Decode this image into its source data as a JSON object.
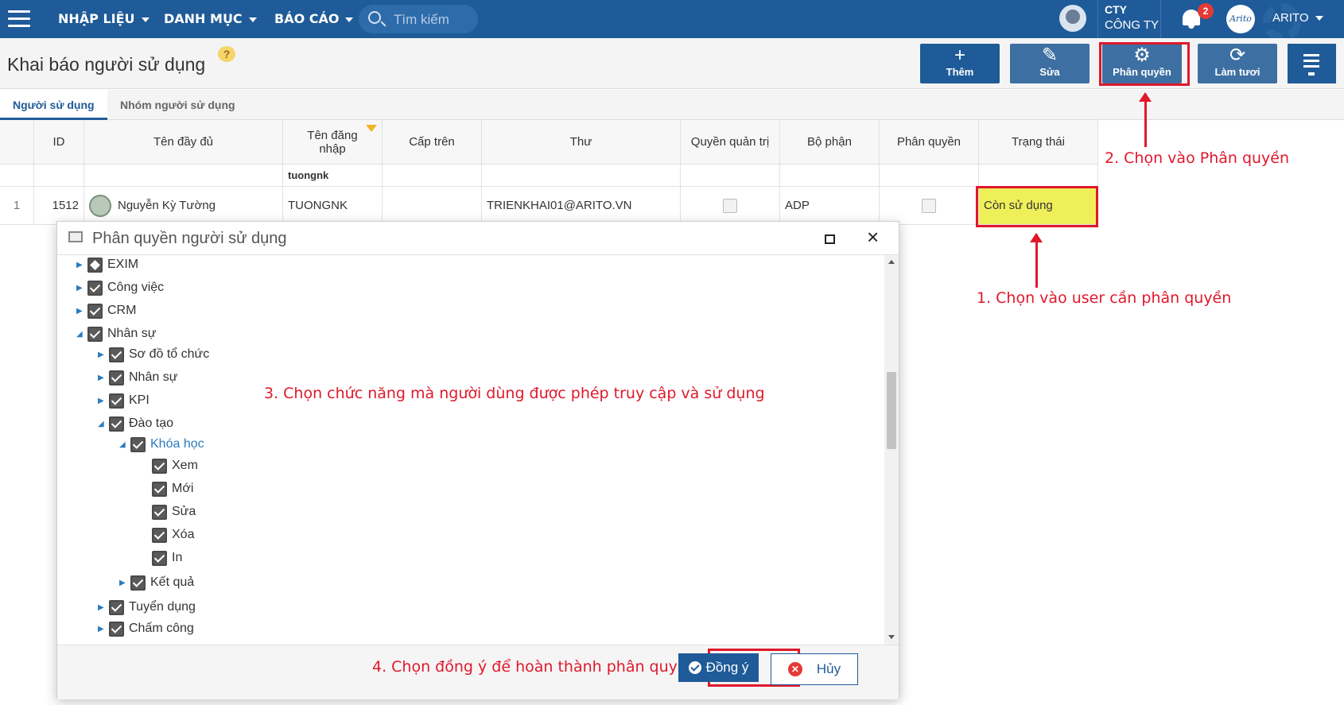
{
  "topbar": {
    "menus": [
      "NHẬP LIỆU",
      "DANH MỤC",
      "BÁO CÁO"
    ],
    "search_placeholder": "Tìm kiếm",
    "company_short": "CTY",
    "company_name": "CÔNG TY",
    "notification_count": "2",
    "avatar_text": "Arito",
    "user_name": "ARITO"
  },
  "header": {
    "title": "Khai báo người sử dụng",
    "help": "?",
    "buttons": [
      {
        "label": "Thêm",
        "icon": "plus-icon"
      },
      {
        "label": "Sửa",
        "icon": "pencil-icon"
      },
      {
        "label": "Phân quyền",
        "icon": "permission-icon"
      },
      {
        "label": "Làm tươi",
        "icon": "refresh-icon"
      }
    ]
  },
  "tabs": [
    "Người sử dụng",
    "Nhóm người sử dụng"
  ],
  "table": {
    "columns": [
      "ID",
      "Tên đầy đủ",
      "Tên đăng nhập",
      "Cấp trên",
      "Thư",
      "Quyền quản trị",
      "Bộ phận",
      "Phân quyền",
      "Trạng thái"
    ],
    "filter_login": "tuongnk",
    "rows": [
      {
        "index": "1",
        "id": "1512",
        "full_name": "Nguyễn Kỳ Tường",
        "login": "TUONGNK",
        "manager": "",
        "email": "TRIENKHAI01@ARITO.VN",
        "admin": false,
        "department": "ADP",
        "permission": false,
        "status": "Còn sử dụng"
      }
    ]
  },
  "annotations": {
    "step1": "1. Chọn vào user cần phân quyền",
    "step2": "2. Chọn vào Phân quyền",
    "step3": "3. Chọn chức năng mà người dùng được phép truy cập và sử dụng",
    "step4": "4. Chọn đồng ý để hoàn  thành phân quyền"
  },
  "dialog": {
    "title": "Phân quyền người sử dụng",
    "close": "×",
    "tree": [
      {
        "label": "EXIM",
        "level": 0,
        "expanded": false,
        "state": "partial"
      },
      {
        "label": "Công việc",
        "level": 0,
        "expanded": false,
        "state": "checked"
      },
      {
        "label": "CRM",
        "level": 0,
        "expanded": false,
        "state": "checked"
      },
      {
        "label": "Nhân sự",
        "level": 0,
        "expanded": true,
        "state": "checked"
      },
      {
        "label": "Sơ đồ tổ chức",
        "level": 1,
        "expanded": false,
        "state": "checked"
      },
      {
        "label": "Nhân sự",
        "level": 1,
        "expanded": false,
        "state": "checked"
      },
      {
        "label": "KPI",
        "level": 1,
        "expanded": false,
        "state": "checked"
      },
      {
        "label": "Đào tạo",
        "level": 1,
        "expanded": true,
        "state": "checked"
      },
      {
        "label": "Khóa học",
        "level": 2,
        "expanded": true,
        "state": "checked"
      },
      {
        "label": "Xem",
        "level": 3,
        "expanded": null,
        "state": "checked"
      },
      {
        "label": "Mới",
        "level": 3,
        "expanded": null,
        "state": "checked"
      },
      {
        "label": "Sửa",
        "level": 3,
        "expanded": null,
        "state": "checked"
      },
      {
        "label": "Xóa",
        "level": 3,
        "expanded": null,
        "state": "checked"
      },
      {
        "label": "In",
        "level": 3,
        "expanded": null,
        "state": "checked"
      },
      {
        "label": "Kết quả",
        "level": 2,
        "expanded": false,
        "state": "checked"
      },
      {
        "label": "Tuyển dụng",
        "level": 1,
        "expanded": false,
        "state": "checked"
      },
      {
        "label": "Chấm công",
        "level": 1,
        "expanded": false,
        "state": "checked"
      }
    ],
    "ok_label": "Đồng ý",
    "cancel_label": "Hủy"
  },
  "colors": {
    "primary": "#1f5b98",
    "annotation": "#e0182b",
    "status_highlight": "#efef5a"
  }
}
